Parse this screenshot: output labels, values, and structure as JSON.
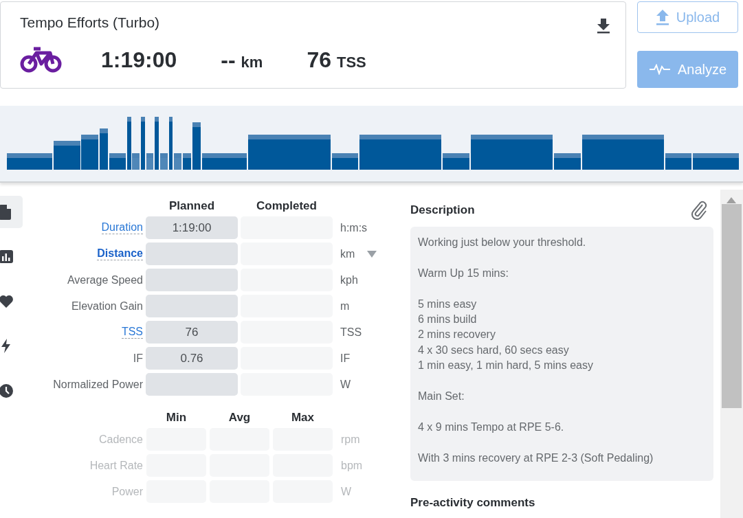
{
  "header": {
    "title": "Tempo Efforts (Turbo)",
    "stats": [
      {
        "value": "1:19:00"
      },
      {
        "value": "--",
        "unit": "km"
      },
      {
        "value": "76",
        "unit": "TSS"
      }
    ]
  },
  "actions": [
    {
      "label": "Upload",
      "kind": "outline"
    },
    {
      "label": "Analyze",
      "kind": "filled"
    }
  ],
  "sidebar": {
    "items": [
      {
        "kind": "document",
        "selected": true
      },
      {
        "kind": "chart",
        "selected": false
      },
      {
        "kind": "heart",
        "selected": false
      },
      {
        "kind": "bolt",
        "selected": false
      },
      {
        "kind": "clock",
        "selected": false
      }
    ]
  },
  "summary": {
    "columns": [
      "Planned",
      "Completed"
    ],
    "rows": [
      {
        "label": "Duration",
        "kind": "link",
        "planned": "1:19:00",
        "unit": "h:m:s",
        "unit_dropdown": false
      },
      {
        "label": "Distance",
        "kind": "bold-link",
        "unit": "km",
        "unit_dropdown": true
      },
      {
        "label": "Average Speed",
        "kind": "plain",
        "unit": "kph",
        "unit_dropdown": false
      },
      {
        "label": "Elevation Gain",
        "kind": "plain",
        "unit": "m",
        "unit_dropdown": false
      },
      {
        "label": "TSS",
        "kind": "link",
        "planned": "76",
        "unit": "TSS",
        "unit_dropdown": false
      },
      {
        "label": "IF",
        "kind": "plain",
        "planned": "0.76",
        "unit": "IF",
        "unit_dropdown": false
      },
      {
        "label": "Normalized Power",
        "kind": "plain",
        "unit": "W",
        "unit_dropdown": false
      }
    ]
  },
  "ranges": {
    "columns": [
      "Min",
      "Avg",
      "Max"
    ],
    "rows": [
      {
        "label": "Cadence",
        "disabled": true,
        "unit": "rpm"
      },
      {
        "label": "Heart Rate",
        "disabled": true,
        "unit": "bpm"
      },
      {
        "label": "Power",
        "disabled": true,
        "unit": "W"
      }
    ]
  },
  "description": {
    "title": "Description",
    "text": "Working just below your threshold.\n\nWarm Up 15 mins:\n\n5 mins easy\n6 mins build\n2 mins recovery\n4 x 30 secs hard, 60 secs easy\n1 min easy, 1 min hard, 5 mins easy\n\nMain Set:\n\n4 x 9 mins Tempo at RPE 5-6.\n\nWith 3 mins recovery at RPE 2-3 (Soft Pedaling)"
  },
  "comments": {
    "title": "Pre-activity comments"
  }
}
